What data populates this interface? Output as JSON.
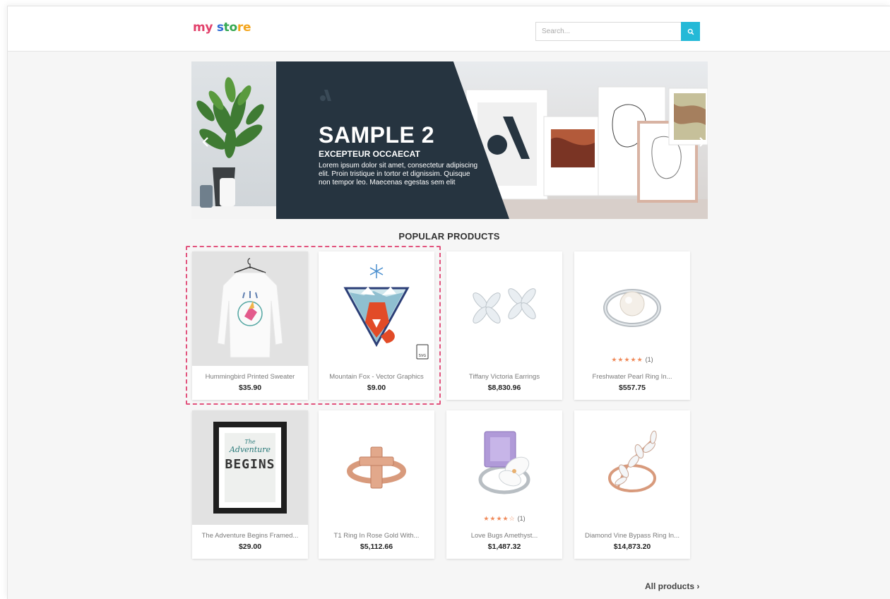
{
  "header": {
    "logo": {
      "part1": "my",
      "part2": " s",
      "part3": "to",
      "part4": "re"
    },
    "search": {
      "placeholder": "Search..."
    }
  },
  "slider": {
    "title": "SAMPLE 2",
    "subtitle": "EXCEPTEUR OCCAECAT",
    "text": "Lorem ipsum dolor sit amet, consectetur adipiscing elit. Proin tristique in tortor et dignissim. Quisque non tempor leo. Maecenas egestas sem elit"
  },
  "section": {
    "title": "POPULAR PRODUCTS"
  },
  "products": [
    {
      "name": "Hummingbird Printed Sweater",
      "price": "$35.90"
    },
    {
      "name": "Mountain Fox - Vector Graphics",
      "price": "$9.00"
    },
    {
      "name": "Tiffany Victoria Earrings",
      "price": "$8,830.96"
    },
    {
      "name": "Freshwater Pearl Ring In...",
      "price": "$557.75",
      "stars": "★★★★★",
      "reviews": "(1)"
    },
    {
      "name": "The Adventure Begins Framed...",
      "price": "$29.00"
    },
    {
      "name": "T1 Ring In Rose Gold With...",
      "price": "$5,112.66"
    },
    {
      "name": "Love Bugs Amethyst...",
      "price": "$1,487.32",
      "stars": "★★★★☆",
      "reviews": "(1)"
    },
    {
      "name": "Diamond Vine Bypass Ring In...",
      "price": "$14,873.20"
    }
  ],
  "poster": {
    "line1": "The",
    "line2": "Adventure",
    "line3": "BEGINS"
  },
  "footer_link": {
    "label": "All products ›"
  },
  "colors": {
    "accent": "#24b9d7",
    "highlight": "#e2547e",
    "star": "#f08a5a",
    "dark_panel": "#263440"
  }
}
